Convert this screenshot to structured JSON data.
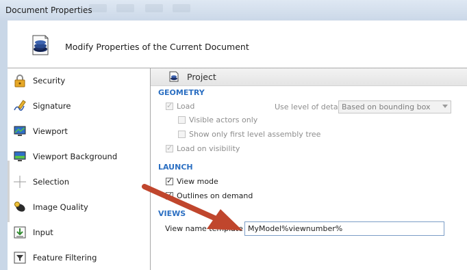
{
  "window": {
    "title": "Document Properties",
    "header_title": "Modify Properties of the Current Document"
  },
  "sidebar": {
    "items": [
      {
        "label": "Security",
        "icon": "lock-icon"
      },
      {
        "label": "Signature",
        "icon": "signature-icon"
      },
      {
        "label": "Viewport",
        "icon": "viewport-icon"
      },
      {
        "label": "Viewport Background",
        "icon": "viewport-background-icon"
      },
      {
        "label": "Selection",
        "icon": "crosshair-icon"
      },
      {
        "label": "Image Quality",
        "icon": "image-quality-icon"
      },
      {
        "label": "Input",
        "icon": "input-icon"
      },
      {
        "label": "Feature Filtering",
        "icon": "filter-icon"
      }
    ]
  },
  "content": {
    "panel_title": "Project",
    "geometry": {
      "title": "GEOMETRY",
      "load": {
        "label": "Load",
        "checked": true,
        "enabled": false
      },
      "visible_actors": {
        "label": "Visible actors only",
        "checked": false,
        "enabled": false
      },
      "first_level": {
        "label": "Show only first level assembly tree",
        "checked": false,
        "enabled": false
      },
      "load_visibility": {
        "label": "Load on visibility",
        "checked": true,
        "enabled": false
      },
      "lod_label": "Use level of detail",
      "lod_value": "Based on bounding box"
    },
    "launch": {
      "title": "LAUNCH",
      "view_mode": {
        "label": "View mode",
        "checked": true
      },
      "outlines": {
        "label": "Outlines on demand",
        "checked": true
      }
    },
    "views": {
      "title": "VIEWS",
      "name_template_label": "View name template",
      "name_template_value": "MyModel%viewnumber%"
    }
  },
  "colors": {
    "section_heading": "#2b6fc2",
    "annotation_arrow": "#c0462d",
    "titlebar": "#d6e1ee"
  }
}
